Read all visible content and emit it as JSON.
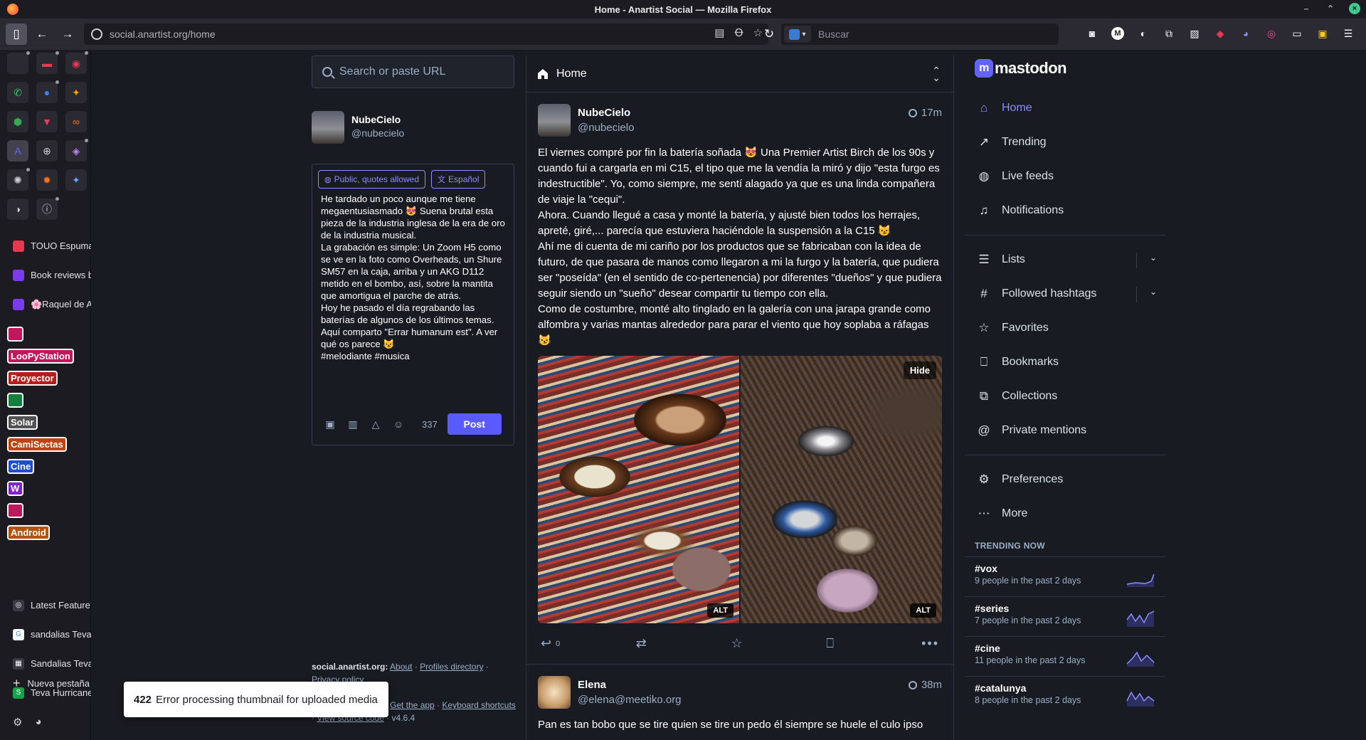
{
  "window": {
    "title": "Home - Anartist Social — Mozilla Firefox"
  },
  "toolbar": {
    "url": "social.anartist.org/home",
    "search_placeholder": "Buscar"
  },
  "pinned_tabs": [
    {
      "icon": "chart-icon",
      "color": "#2b2a33",
      "glyph": "✳"
    },
    {
      "icon": "chat-icon",
      "color": "#e63950",
      "glyph": "▬"
    },
    {
      "icon": "eye-icon",
      "color": "#e63950",
      "glyph": "◉"
    },
    {
      "icon": "whatsapp-icon",
      "color": "#25d366",
      "glyph": "✆"
    },
    {
      "icon": "messenger-icon",
      "color": "#3b82f6",
      "glyph": "●"
    },
    {
      "icon": "bird-icon",
      "color": "#f59e0b",
      "glyph": "✦"
    },
    {
      "icon": "maps-icon",
      "color": "#34a853",
      "glyph": "⬢"
    },
    {
      "icon": "pocket-icon",
      "color": "#ef3f56",
      "glyph": "▼"
    },
    {
      "icon": "link-icon",
      "color": "#f97316",
      "glyph": "∞"
    },
    {
      "icon": "anartist-icon",
      "color": "#6364ff",
      "glyph": "A"
    },
    {
      "icon": "globe-icon",
      "color": "#cfcfd8",
      "glyph": "⊕"
    },
    {
      "icon": "shield-icon",
      "color": "#c084fc",
      "glyph": "◈"
    },
    {
      "icon": "ai-icon",
      "color": "#cfcfd8",
      "glyph": "✺"
    },
    {
      "icon": "sparkle-icon",
      "color": "#f97316",
      "glyph": "✹"
    },
    {
      "icon": "gemini-icon",
      "color": "#60a5fa",
      "glyph": "✦"
    },
    {
      "icon": "bot-icon",
      "color": "#cfcfd8",
      "glyph": "◑"
    },
    {
      "icon": "info-icon",
      "color": "#cfcfd8",
      "glyph": "ⓘ"
    }
  ],
  "sidebar_tabs": [
    {
      "label": "TOUO Espuma",
      "fav_color": "#e63950"
    },
    {
      "label": "Book reviews b",
      "fav_color": "#7c3aed"
    },
    {
      "label": "🌸Raquel de A",
      "fav_color": "#7c3aed"
    }
  ],
  "tab_groups": [
    {
      "label": "",
      "color": "#c2185b"
    },
    {
      "label": "LooPyStation",
      "color": "#c2185b"
    },
    {
      "label": "Proyector",
      "color": "#b91c1c"
    },
    {
      "label": "",
      "color": "#15803d"
    },
    {
      "label": "Solar",
      "color": "#525252"
    },
    {
      "label": "CamiSectas",
      "color": "#c2410c"
    },
    {
      "label": "Cine",
      "color": "#1d4ed8"
    },
    {
      "label": "W",
      "color": "#7e22ce"
    },
    {
      "label": "",
      "color": "#be185d"
    },
    {
      "label": "Android",
      "color": "#b45309"
    }
  ],
  "sidebar_tabs2": [
    {
      "label": "Latest Feature",
      "fav_color": "#3a3944",
      "glyph": "◎"
    },
    {
      "label": "sandalias Teva",
      "fav_color": "#ffffff",
      "glyph": "G"
    },
    {
      "label": "Sandalias Teva",
      "fav_color": "#3a3944",
      "glyph": "▦"
    },
    {
      "label": "Teva Hurricane",
      "fav_color": "#16a34a",
      "glyph": "S"
    }
  ],
  "sidebar": {
    "new_tab": "Nueva pestaña"
  },
  "compose": {
    "search_placeholder": "Search or paste URL",
    "display_name": "NubeCielo",
    "handle": "@nubecielo",
    "visibility": "Public, quotes allowed",
    "language": "Español",
    "text": "He tardado un poco aunque me tiene megaentusiasmado 😻 Suena brutal esta pieza de la industria inglesa de la era de oro de la industria musical.\nLa grabación es simple: Un Zoom H5 como se ve en la foto como Overheads, un Shure SM57 en la caja, arriba y un AKG D112 metido en el bombo, así, sobre la mantita que amortigua el parche de atrás.\nHoy he pasado el día regrabando las baterías de algunos de los últimos temas.\nAquí comparto \"Errar humanum est\". A ver qué os parece 😼\n#melodiante #musica",
    "char_count": "337",
    "post_label": "Post"
  },
  "footer": {
    "server": "social.anartist.org:",
    "about": "About",
    "profiles": "Profiles directory",
    "privacy": "Privacy policy",
    "get_app": "Get the app",
    "keyboard": "Keyboard shortcuts",
    "source": "View source code",
    "version": "v4.6.4"
  },
  "timeline": {
    "title": "Home",
    "posts": [
      {
        "name": "NubeCielo",
        "handle": "@nubecielo",
        "time": "17m",
        "body": [
          "El viernes compré por fin la batería soñada 😻 Una Premier Artist Birch de los 90s y cuando fui a cargarla en mi C15, el tipo que me la vendía la miró y dijo \"esta furgo es indestructible\". Yo, como siempre, me sentí alagado ya que es una linda compañera de viaje la \"cequi\".",
          "Ahora. Cuando llegué a casa y monté la batería, y ajusté bien todos los herrajes, apreté, giré,... parecía que estuviera haciéndole la suspensión a la C15 😼",
          "Ahí me di cuenta de mi cariño por los productos que se fabricaban con la idea de futuro, de que pasara de manos como llegaron a mi la furgo y la batería, que pudiera ser \"poseída\" (en el sentido de co-pertenencia) por diferentes \"dueños\" y que pudiera seguir siendo un \"sueño\" desear compartir tu tiempo con ella.",
          "Como de costumbre, monté alto tinglado en la galería con una jarapa grande como alfombra y varias mantas alrededor para parar el viento que hoy soplaba a ráfagas 😼"
        ],
        "alt_label": "ALT",
        "hide_label": "Hide",
        "replies": "0"
      },
      {
        "name": "Elena",
        "handle": "@elena@meetiko.org",
        "time": "38m",
        "body": [
          "Pan es tan bobo que se tire quien se tire un pedo él siempre se huele el culo ipso"
        ]
      }
    ]
  },
  "nav": {
    "logo": "mastodon",
    "items": [
      {
        "label": "Home",
        "icon": "home-icon",
        "glyph": "⌂"
      },
      {
        "label": "Trending",
        "icon": "trending-icon",
        "glyph": "↗"
      },
      {
        "label": "Live feeds",
        "icon": "globe-icon",
        "glyph": "◍"
      },
      {
        "label": "Notifications",
        "icon": "bell-icon",
        "glyph": "♫"
      }
    ],
    "items2": [
      {
        "label": "Lists",
        "icon": "list-icon",
        "glyph": "☰"
      },
      {
        "label": "Followed hashtags",
        "icon": "hashtag-icon",
        "glyph": "#"
      },
      {
        "label": "Favorites",
        "icon": "star-icon",
        "glyph": "☆"
      },
      {
        "label": "Bookmarks",
        "icon": "bookmark-icon",
        "glyph": "⎕"
      },
      {
        "label": "Collections",
        "icon": "collections-icon",
        "glyph": "⧉"
      },
      {
        "label": "Private mentions",
        "icon": "at-icon",
        "glyph": "@"
      }
    ],
    "items3": [
      {
        "label": "Preferences",
        "icon": "gear-icon",
        "glyph": "⚙"
      },
      {
        "label": "More",
        "icon": "more-icon",
        "glyph": "⋯"
      }
    ],
    "trending_title": "TRENDING NOW",
    "trends": [
      {
        "tag": "#vox",
        "people": "9 people in the past 2 days"
      },
      {
        "tag": "#series",
        "people": "7 people in the past 2 days"
      },
      {
        "tag": "#cine",
        "people": "11 people in the past 2 days"
      },
      {
        "tag": "#catalunya",
        "people": "8 people in the past 2 days"
      }
    ]
  },
  "toast": {
    "code": "422",
    "message": "Error processing thumbnail for uploaded media"
  }
}
